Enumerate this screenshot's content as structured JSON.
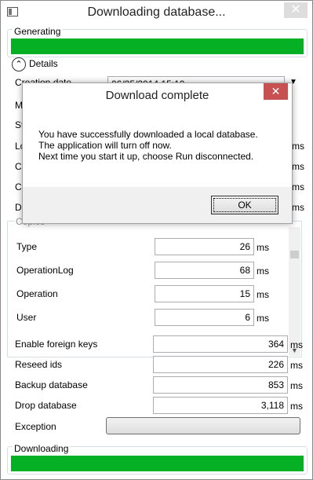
{
  "window": {
    "title": "Downloading database...",
    "close_glyph": "✕"
  },
  "generating": {
    "label": "Generating",
    "progress": 1.0
  },
  "details": {
    "label": "Details",
    "icon": "chevron-up-icon"
  },
  "creation": {
    "label": "Creation date",
    "value": "06/25/2014 15:10"
  },
  "behind_labels": [
    "M",
    "St",
    "Lo",
    "Cr",
    "Cr",
    "Di"
  ],
  "behind_units": [
    "ms",
    "ms",
    "ms",
    "ms"
  ],
  "copies": {
    "label": "Copies",
    "rows": [
      {
        "label": "Type",
        "value": "26",
        "unit": "ms"
      },
      {
        "label": "OperationLog",
        "value": "68",
        "unit": "ms"
      },
      {
        "label": "Operation",
        "value": "15",
        "unit": "ms"
      },
      {
        "label": "User",
        "value": "6",
        "unit": "ms"
      }
    ]
  },
  "steps": [
    {
      "label": "Enable foreign keys",
      "value": "364",
      "unit": "ms"
    },
    {
      "label": "Reseed ids",
      "value": "226",
      "unit": "ms"
    },
    {
      "label": "Backup database",
      "value": "853",
      "unit": "ms"
    },
    {
      "label": "Drop database",
      "value": "3,118",
      "unit": "ms"
    }
  ],
  "exception": {
    "label": "Exception"
  },
  "downloading": {
    "label": "Downloading",
    "progress": 1.0
  },
  "dialog": {
    "title": "Download complete",
    "close_glyph": "✕",
    "lines": [
      "You have successfully downloaded a local database.",
      "The application will turn off now.",
      "Next time you start it up, choose Run disconnected."
    ],
    "ok_label": "OK"
  },
  "colors": {
    "progress": "#06b025",
    "dialog_close": "#c75050"
  }
}
